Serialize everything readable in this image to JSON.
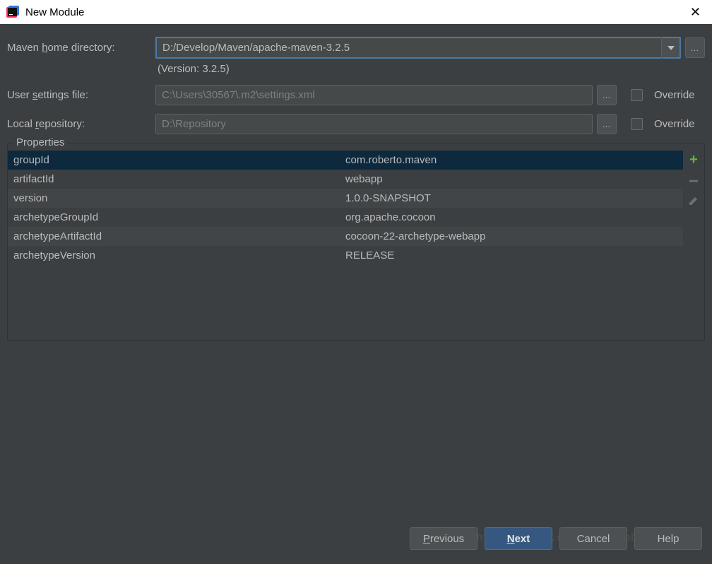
{
  "titlebar": {
    "title": "New Module"
  },
  "form": {
    "maven_home_label_pre": "Maven ",
    "maven_home_label_u": "h",
    "maven_home_label_post": "ome directory:",
    "maven_home_value": "D:/Develop/Maven/apache-maven-3.2.5",
    "version_text": "(Version: 3.2.5)",
    "user_settings_label_pre": "User ",
    "user_settings_label_u": "s",
    "user_settings_label_post": "ettings file:",
    "user_settings_value": "C:\\Users\\30567\\.m2\\settings.xml",
    "local_repo_label_pre": "Local ",
    "local_repo_label_u": "r",
    "local_repo_label_post": "epository:",
    "local_repo_value": "D:\\Repository",
    "override_label": "Override"
  },
  "properties": {
    "header": "Properties",
    "rows": [
      {
        "key": "groupId",
        "val": "com.roberto.maven"
      },
      {
        "key": "artifactId",
        "val": "webapp"
      },
      {
        "key": "version",
        "val": "1.0.0-SNAPSHOT"
      },
      {
        "key": "archetypeGroupId",
        "val": "org.apache.cocoon"
      },
      {
        "key": "archetypeArtifactId",
        "val": "cocoon-22-archetype-webapp"
      },
      {
        "key": "archetypeVersion",
        "val": "RELEASE"
      }
    ]
  },
  "buttons": {
    "previous_u": "P",
    "previous_post": "revious",
    "next_u": "N",
    "next_post": "ext",
    "cancel": "Cancel",
    "help": "Help"
  },
  "watermark": "http://blog.csdn.net/RobertoHuang"
}
